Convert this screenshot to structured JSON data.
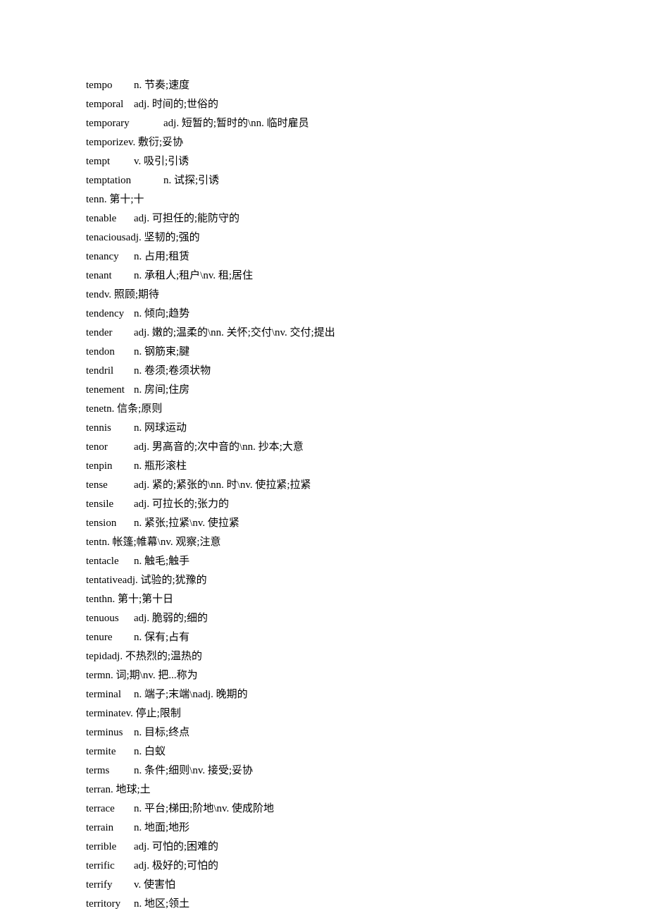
{
  "entries": [
    {
      "word": "tempo",
      "def": "n. 节奏;速度"
    },
    {
      "word": "temporal",
      "def": "adj. 时间的;世俗的"
    },
    {
      "word": "temporary",
      "def": "adj. 短暂的;暂时的\\nn. 临时雇员"
    },
    {
      "word": "temporize",
      "def": "v. 敷衍;妥协"
    },
    {
      "word": "tempt",
      "def": "v. 吸引;引诱"
    },
    {
      "word": "temptation",
      "def": "n. 试探;引诱"
    },
    {
      "word": "ten",
      "def": "n. 第十;十"
    },
    {
      "word": "tenable",
      "def": "adj. 可担任的;能防守的"
    },
    {
      "word": "tenacious",
      "def": "adj. 坚韧的;强的"
    },
    {
      "word": "tenancy",
      "def": "n. 占用;租赁"
    },
    {
      "word": "tenant",
      "def": "n. 承租人;租户\\nv. 租;居住"
    },
    {
      "word": "tend",
      "def": "v. 照顾;期待"
    },
    {
      "word": "tendency",
      "def": "n. 倾向;趋势"
    },
    {
      "word": "tender",
      "def": "adj. 嫩的;温柔的\\nn. 关怀;交付\\nv. 交付;提出"
    },
    {
      "word": "tendon",
      "def": "n. 钢筋束;腱"
    },
    {
      "word": "tendril",
      "def": "n. 卷须;卷须状物"
    },
    {
      "word": "tenement",
      "def": "n. 房间;住房"
    },
    {
      "word": "tenet",
      "def": "n. 信条;原则"
    },
    {
      "word": "tennis",
      "def": "n. 网球运动"
    },
    {
      "word": "tenor",
      "def": "adj. 男高音的;次中音的\\nn. 抄本;大意"
    },
    {
      "word": "tenpin",
      "def": "n. 瓶形滚柱"
    },
    {
      "word": "tense",
      "def": "adj. 紧的;紧张的\\nn. 时\\nv. 使拉紧;拉紧"
    },
    {
      "word": "tensile",
      "def": "adj. 可拉长的;张力的"
    },
    {
      "word": "tension",
      "def": "n. 紧张;拉紧\\nv. 使拉紧"
    },
    {
      "word": "tent",
      "def": "n. 帐篷;帷幕\\nv. 观察;注意"
    },
    {
      "word": "tentacle",
      "def": "n. 触毛;触手"
    },
    {
      "word": "tentative",
      "def": "adj. 试验的;犹豫的"
    },
    {
      "word": "tenth",
      "def": "n. 第十;第十日"
    },
    {
      "word": "tenuous",
      "def": "adj. 脆弱的;细的"
    },
    {
      "word": "tenure",
      "def": "n. 保有;占有"
    },
    {
      "word": "tepid",
      "def": "adj. 不热烈的;温热的"
    },
    {
      "word": "term",
      "def": "n. 词;期\\nv. 把...称为"
    },
    {
      "word": "terminal",
      "def": "n. 端子;末端\\nadj. 晚期的"
    },
    {
      "word": "terminate",
      "def": "v. 停止;限制"
    },
    {
      "word": "terminus",
      "def": "n. 目标;终点"
    },
    {
      "word": "termite",
      "def": "n. 白蚁"
    },
    {
      "word": "terms",
      "def": "n. 条件;细则\\nv. 接受;妥协"
    },
    {
      "word": "terra",
      "def": "n. 地球;土"
    },
    {
      "word": "terrace",
      "def": "n. 平台;梯田;阶地\\nv. 使成阶地"
    },
    {
      "word": "terrain",
      "def": "n. 地面;地形"
    },
    {
      "word": "terrible",
      "def": "adj. 可怕的;困难的"
    },
    {
      "word": "terrific",
      "def": "adj. 极好的;可怕的"
    },
    {
      "word": "terrify",
      "def": "v. 使害怕"
    },
    {
      "word": "territory",
      "def": "n. 地区;领土"
    }
  ]
}
